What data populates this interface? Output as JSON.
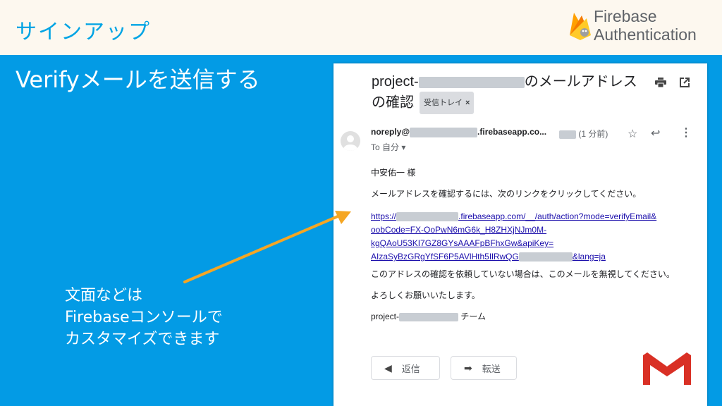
{
  "slide": {
    "title": "サインアップ",
    "brand_line1": "Firebase",
    "brand_line2": "Authentication",
    "heading": "Verifyメールを送信する",
    "note_lines": [
      "文面などは",
      "Firebaseコンソールで",
      "カスタマイズできます"
    ]
  },
  "email": {
    "subject_prefix": "project-",
    "subject_suffix": "のメールアドレス",
    "subject_line2": "の確認",
    "label": "受信トレイ",
    "label_close": "×",
    "sender_prefix": "noreply@",
    "sender_suffix": ".firebaseapp.co...",
    "time": "(1 分前)",
    "to": "To 自分 ▾",
    "greeting": "中安佑一 様",
    "intro": "メールアドレスを確認するには、次のリンクをクリックしてください。",
    "link_line1_prefix": "https://",
    "link_line1_suffix": ".firebaseapp.com/__/auth/action?mode=verifyEmail&",
    "link_line2": "oobCode=FX-OoPwN6mG6k_H8ZHXjNJm0M-",
    "link_line3": "kgQAoU53KI7GZ8GYsAAAFpBFhxGw&apiKey=",
    "link_line4_prefix": "AIzaSyBzGRgYfSF6P5AVlHth5IlRwQG",
    "link_line4_suffix": "&lang=ja",
    "ignore": "このアドレスの確認を依頼していない場合は、このメールを無視してください。",
    "closing": "よろしくお願いいたします。",
    "sign_prefix": "project-",
    "sign_suffix": " チーム",
    "reply_label": "返信",
    "forward_label": "転送"
  },
  "colors": {
    "background": "#039be5",
    "topbar": "#fdf8ef",
    "title": "#00a4e4",
    "arrow": "#f5a623",
    "link": "#1a0dab"
  },
  "icons": [
    "firebase-flame-icon",
    "print-icon",
    "popout-icon",
    "avatar-icon",
    "star-icon",
    "reply-icon",
    "more-icon",
    "gmail-icon"
  ]
}
